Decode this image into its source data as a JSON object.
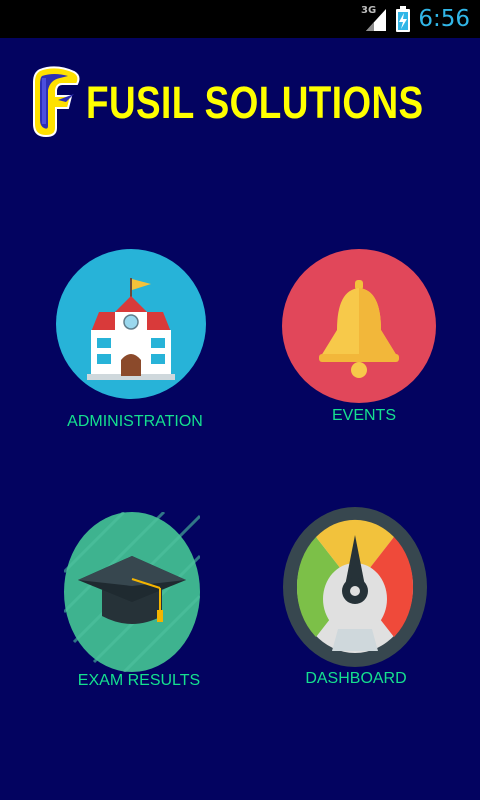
{
  "status_bar": {
    "time": "6:56",
    "network": "3G",
    "icons": [
      "signal-icon",
      "battery-charging-icon"
    ],
    "time_color": "#31b6e7"
  },
  "header": {
    "logo_icon": "fusil-f-logo-icon",
    "title": "FUSIL SOLUTIONS",
    "title_color": "#ffff00"
  },
  "menu": [
    {
      "label": "ADMINISTRATION",
      "icon": "school-building-icon",
      "circle_color": "#27b3d8"
    },
    {
      "label": "EVENTS",
      "icon": "bell-icon",
      "circle_color": "#e1475a"
    },
    {
      "label": "EXAM RESULTS",
      "icon": "graduation-cap-icon",
      "circle_color": "#3eb38f"
    },
    {
      "label": "DASHBOARD",
      "icon": "speedometer-gauge-icon",
      "circle_color": "#37474f"
    }
  ],
  "colors": {
    "background": "#030360",
    "label": "#15e08f"
  }
}
